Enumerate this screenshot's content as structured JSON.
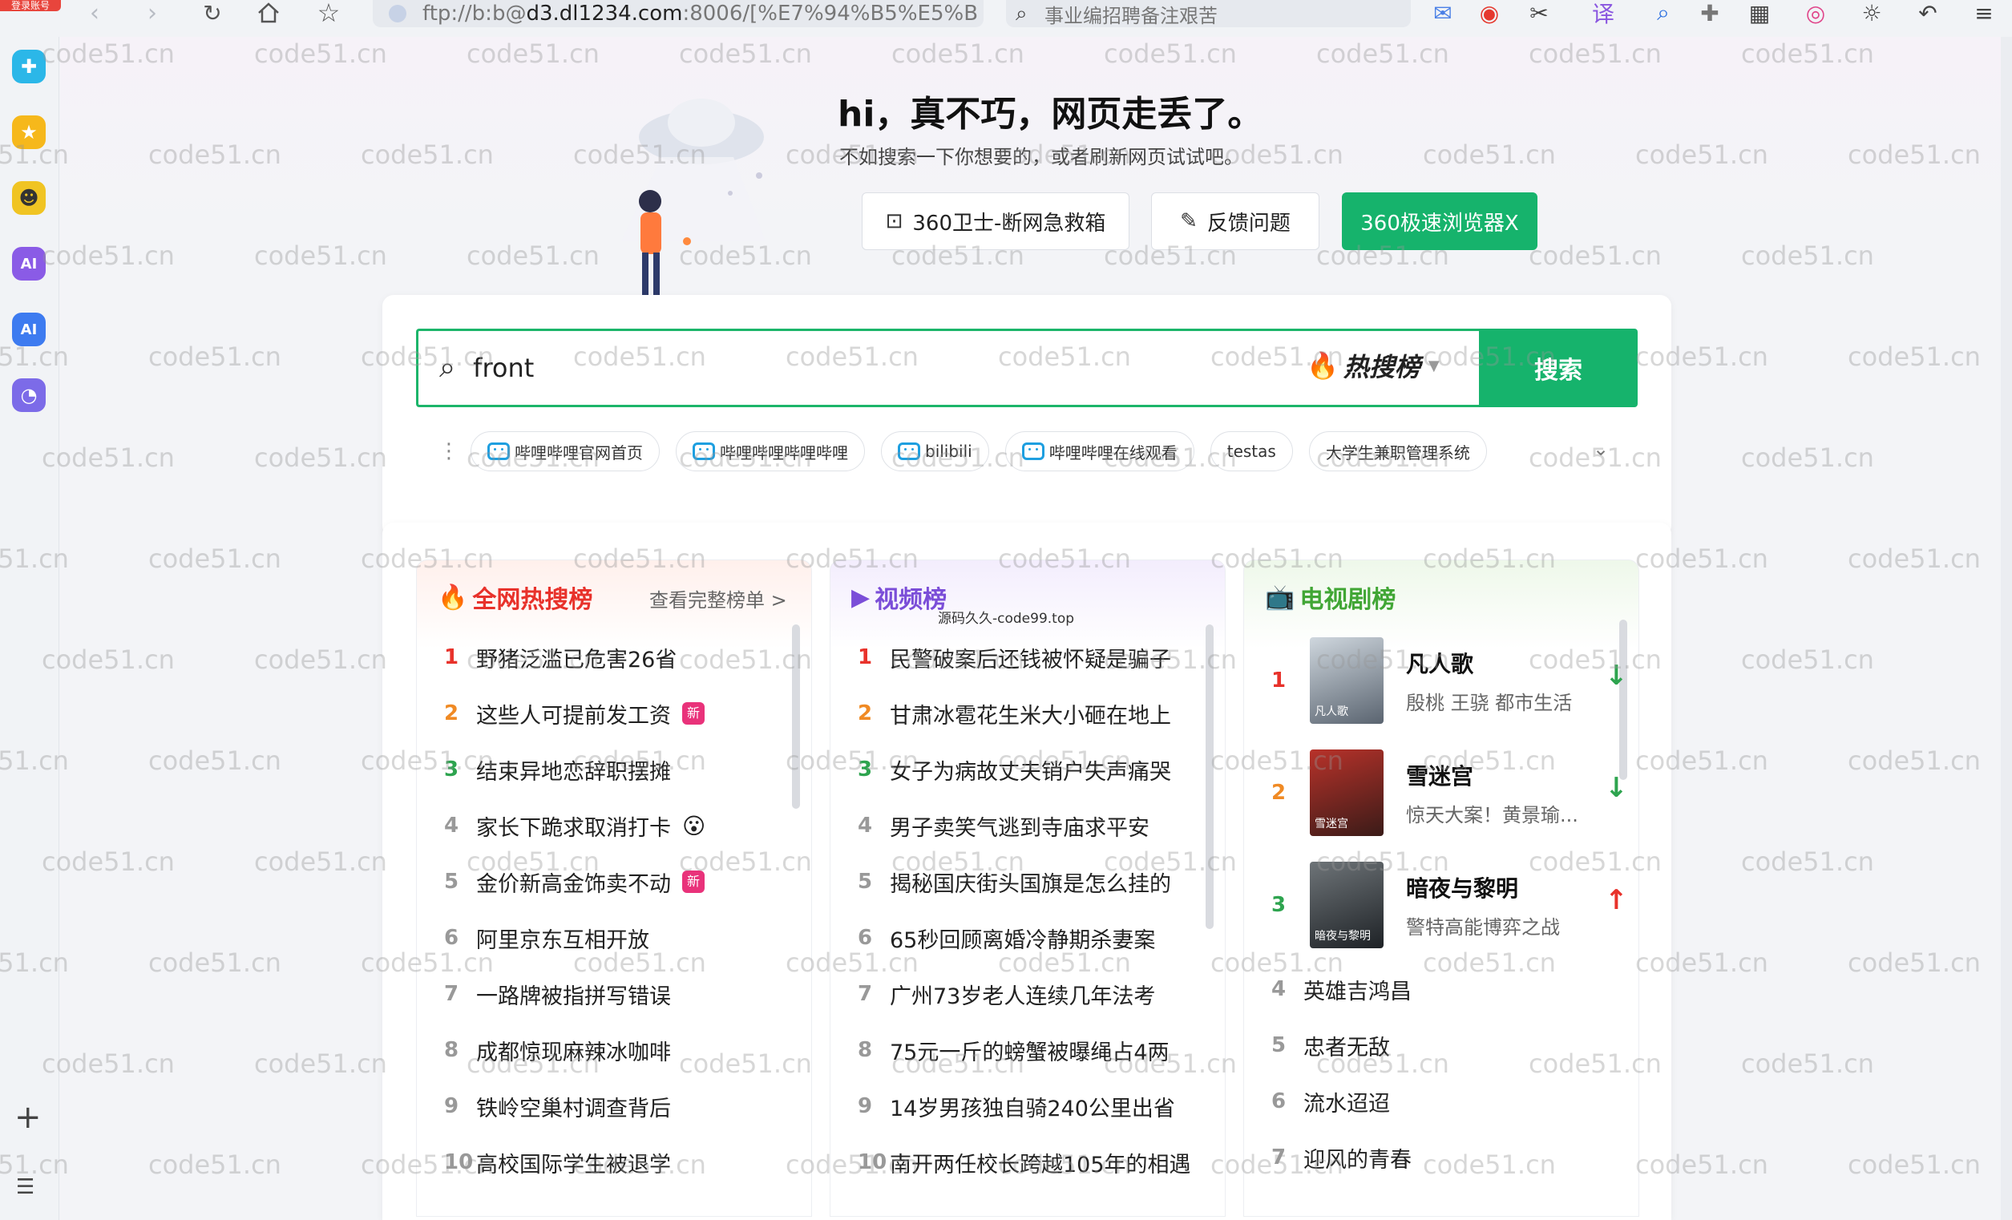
{
  "browser": {
    "login_badge": "登录账号",
    "address": {
      "scheme_user": "ftp://b:b@",
      "host": "d3.dl1234.com",
      "rest": ":8006/[%E7%94%B5%E5%B"
    },
    "search_placeholder": "事业编招聘备注艰苦"
  },
  "error": {
    "title": "hi，真不巧，网页走丢了。",
    "subtitle": "不如搜索一下你想要的，或者刷新网页试试吧。",
    "buttons": {
      "rescue": "360卫士-断网急救箱",
      "feedback": "反馈问题",
      "browser": "360极速浏览器X"
    }
  },
  "search": {
    "query": "front",
    "hot_tag": "热搜榜",
    "button": "搜索",
    "history": [
      {
        "label": "哔哩哔哩官网首页",
        "icon": "bilibili-tv-icon"
      },
      {
        "label": "哔哩哔哩哔哩哔哩",
        "icon": "bilibili-tv-icon"
      },
      {
        "label": "bilibili",
        "icon": "bilibili-tv-icon"
      },
      {
        "label": "哔哩哔哩在线观看",
        "icon": "bilibili-tv-icon"
      },
      {
        "label": "testas",
        "icon": ""
      },
      {
        "label": "大学生兼职管理系统",
        "icon": ""
      }
    ]
  },
  "ranks": {
    "hot": {
      "title": "全网热搜榜",
      "view_all": "查看完整榜单 >",
      "items": [
        {
          "n": "1",
          "text": "野猪泛滥已危害26省",
          "badge": ""
        },
        {
          "n": "2",
          "text": "这些人可提前发工资",
          "badge": "新"
        },
        {
          "n": "3",
          "text": "结束异地恋辞职摆摊",
          "badge": ""
        },
        {
          "n": "4",
          "text": "家长下跪求取消打卡",
          "badge": "😮"
        },
        {
          "n": "5",
          "text": "金价新高金饰卖不动",
          "badge": "新"
        },
        {
          "n": "6",
          "text": "阿里京东互相开放",
          "badge": ""
        },
        {
          "n": "7",
          "text": "一路牌被指拼写错误",
          "badge": ""
        },
        {
          "n": "8",
          "text": "成都惊现麻辣冰咖啡",
          "badge": ""
        },
        {
          "n": "9",
          "text": "铁岭空巢村调查背后",
          "badge": ""
        },
        {
          "n": "10",
          "text": "高校国际学生被退学",
          "badge": ""
        }
      ]
    },
    "video": {
      "title": "视频榜",
      "overlay": "源码久久-code99.top",
      "items": [
        {
          "n": "1",
          "text": "民警破案后还钱被怀疑是骗子"
        },
        {
          "n": "2",
          "text": "甘肃冰雹花生米大小砸在地上"
        },
        {
          "n": "3",
          "text": "女子为病故丈夫销户失声痛哭"
        },
        {
          "n": "4",
          "text": "男子卖笑气逃到寺庙求平安"
        },
        {
          "n": "5",
          "text": "揭秘国庆街头国旗是怎么挂的"
        },
        {
          "n": "6",
          "text": "65秒回顾离婚冷静期杀妻案"
        },
        {
          "n": "7",
          "text": "广州73岁老人连续几年法考"
        },
        {
          "n": "8",
          "text": "75元一斤的螃蟹被曝绳占4两"
        },
        {
          "n": "9",
          "text": "14岁男孩独自骑240公里出省"
        },
        {
          "n": "10",
          "text": "南开两任校长跨越105年的相遇"
        }
      ]
    },
    "tv": {
      "title": "电视剧榜",
      "top": [
        {
          "n": "1",
          "name": "凡人歌",
          "desc": "殷桃 王骁 都市生活",
          "trend": "down",
          "poster_text": "凡人歌"
        },
        {
          "n": "2",
          "name": "雪迷宫",
          "desc": "惊天大案！黄景瑜...",
          "trend": "down",
          "poster_text": "雪迷宫"
        },
        {
          "n": "3",
          "name": "暗夜与黎明",
          "desc": "警特高能博弈之战",
          "trend": "up",
          "poster_text": "暗夜与黎明"
        }
      ],
      "rest": [
        {
          "n": "4",
          "text": "英雄吉鸿昌"
        },
        {
          "n": "5",
          "text": "忠者无敌"
        },
        {
          "n": "6",
          "text": "流水迢迢"
        },
        {
          "n": "7",
          "text": "迎风的青春"
        }
      ]
    }
  },
  "watermark": "code51.cn",
  "colors": {
    "green": "#16b36c",
    "hot_red": "#e8322b",
    "video_purple": "#7b4ed8",
    "tv_green": "#41a635"
  }
}
